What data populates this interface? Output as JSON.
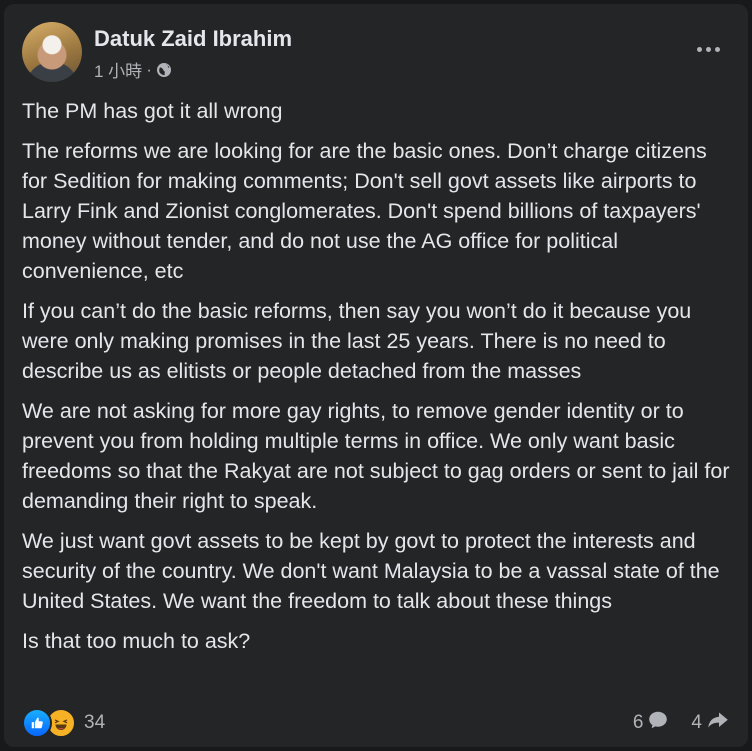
{
  "post": {
    "author": "Datuk Zaid Ibrahim",
    "time": "1 小時",
    "separator": "·",
    "audience_icon": "globe-icon",
    "more_icon": "more-options-icon",
    "paragraphs": [
      "The PM has got it all wrong",
      "The reforms we are looking for are the basic ones. Don’t charge citizens for Sedition for making comments; Don't sell govt assets like airports to Larry Fink and Zionist conglomerates. Don't spend billions of taxpayers' money without tender, and do not use the AG office for political convenience, etc",
      "If you can’t do the basic reforms, then say you won’t do it because you were only making promises in the last 25 years. There is no need to describe us as elitists or people detached from the masses",
      "We are not asking for more gay rights, to remove gender identity or to prevent you from holding multiple terms in office. We only want basic freedoms so that the Rakyat are not subject to gag orders or sent to jail for demanding their right to speak.",
      "We just want govt assets to be kept by govt to protect the interests and security of the country. We don't want Malaysia to be a vassal state of the United States. We want the freedom to talk about these things",
      "Is that too much to ask?"
    ]
  },
  "footer": {
    "reaction_icons": [
      "like-icon",
      "haha-icon"
    ],
    "reaction_count": "34",
    "comment_count": "6",
    "comment_icon": "comment-icon",
    "share_count": "4",
    "share_icon": "share-icon"
  },
  "colors": {
    "background": "#18191a",
    "card": "#242526",
    "primary_text": "#e4e6eb",
    "secondary_text": "#b0b3b8",
    "like_blue": "#0866ff",
    "haha_yellow": "#f7b125"
  }
}
